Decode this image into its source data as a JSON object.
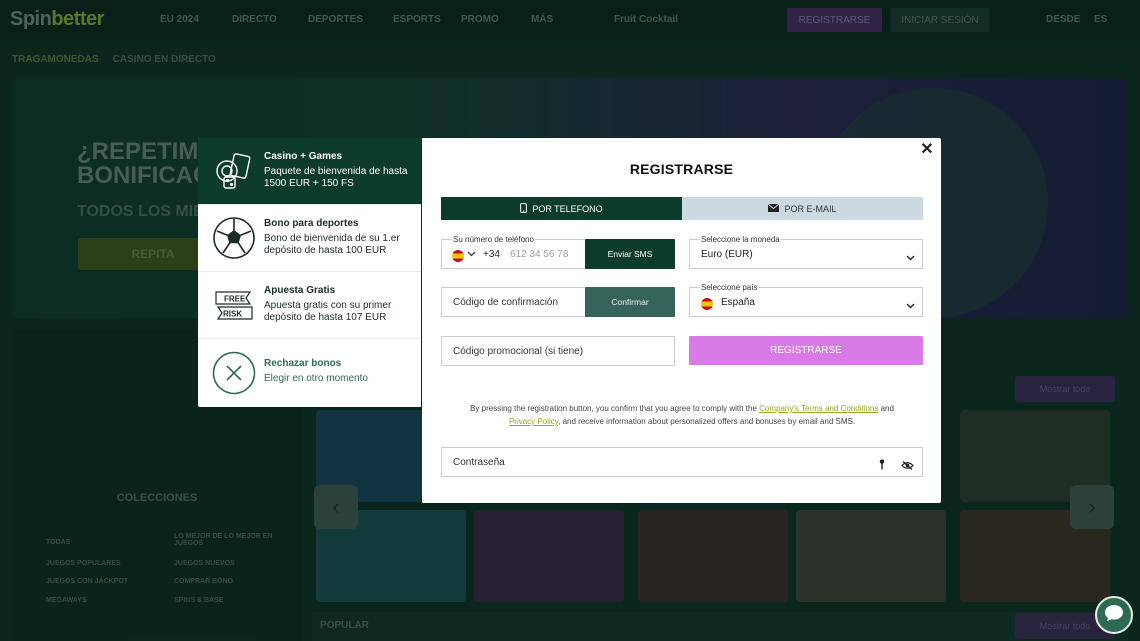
{
  "background": {
    "logo": {
      "part1": "Spin",
      "part2": "better"
    },
    "nav": [
      "EU 2024",
      "DIRECTO",
      "DEPORTES",
      "ESPORTS",
      "PROMO",
      "MÁS",
      "Fruit Cocktail"
    ],
    "register_label": "REGISTRARSE",
    "login_label": "INICIAR SESIÓN",
    "lang1": "DESDE",
    "lang2": "ES",
    "breadcrumbs": [
      "TRAGAMONEDAS",
      "CASINO EN DIRECTO"
    ],
    "banner": {
      "title": "¿REPETIMOS? BONIFICACIÓN",
      "subtitle": "TODOS LOS MIÉ...",
      "button": "REPITA"
    },
    "collections_title": "COLECCIONES",
    "collections": [
      "TODAS",
      "LO MEJOR DE LO MEJOR EN JUEGOS",
      "JUEGOS POPULARES",
      "JUEGOS NUEVOS",
      "JUEGOS CON JACKPOT",
      "COMPRAR BONO",
      "MEGAWAYS",
      "SPINS & BASE"
    ],
    "show_more": "Mostrar todo",
    "popular_label": "POPULAR"
  },
  "bonus_panel": {
    "items": [
      {
        "title": "Casino + Games",
        "desc": "Paquete de bienvenida de hasta 1500 EUR + 150 FS",
        "icon": "casino-chips-icon",
        "selected": true
      },
      {
        "title": "Bono para deportes",
        "desc": "Bono de bienvenida de su 1.er depósito de hasta 100 EUR",
        "icon": "soccer-ball-icon",
        "selected": false
      },
      {
        "title": "Apuesta Gratis",
        "desc": "Apuesta gratis con su primer depósito de hasta 107 EUR",
        "icon": "free-risk-icon",
        "selected": false
      },
      {
        "title": "Rechazar bonos",
        "desc": "Elegir en otro momento",
        "icon": "close-circle-icon",
        "selected": false
      }
    ],
    "free_text": "FREE",
    "risk_text": "RISK"
  },
  "modal": {
    "title": "REGISTRARSE",
    "tabs": {
      "phone": "POR TELEFONO",
      "email": "POR E-MAIL"
    },
    "phone": {
      "label": "Su número de teléfono",
      "code": "+34",
      "placeholder": "612 34 56 78",
      "send_sms": "Enviar SMS"
    },
    "currency": {
      "label": "Seleccione la moneda",
      "value": "Euro (EUR)"
    },
    "confirmation": {
      "placeholder": "Código de confirmación",
      "button": "Confirmar"
    },
    "country": {
      "label": "Seleccione país",
      "value": "España"
    },
    "promo": {
      "placeholder": "Código promocional (si tiene)"
    },
    "register_button": "REGISTRARSE",
    "terms": {
      "before": "By pressing the registration button, you confirm that you agree to comply with the ",
      "link1": "Company's Terms and Conditions",
      "mid": " and ",
      "link2": "Privacy Policy",
      "after": ", and receive information about personalized offers and bonuses by email and SMS."
    },
    "password": {
      "placeholder": "Contraseña"
    }
  },
  "colors": {
    "primary_dark": "#0d3b2c",
    "register_pink": "#d97be6",
    "tab_inactive": "#cdd9e0",
    "link_olive": "#a0a417"
  }
}
